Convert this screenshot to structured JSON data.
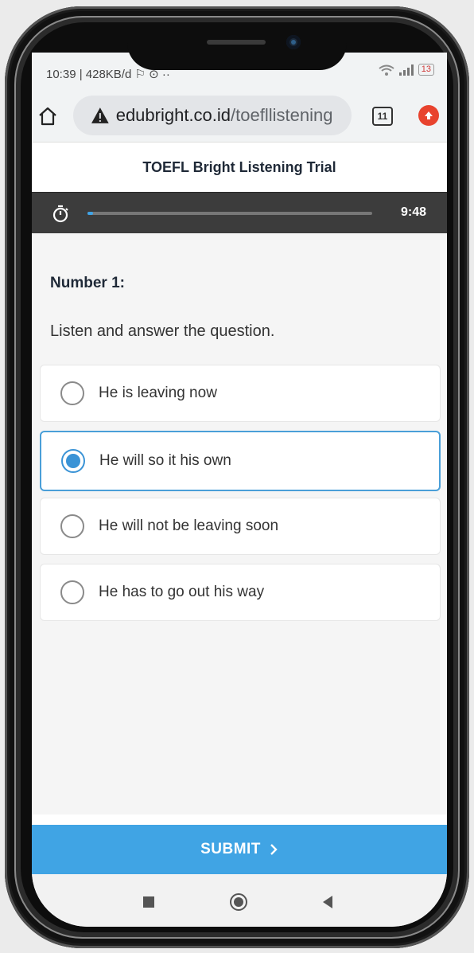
{
  "status_bar": {
    "left_text": "10:39 | 428KB/d ⚐ ⊙ ··",
    "battery": "13"
  },
  "browser": {
    "url_domain": "edubright.co.id",
    "url_path": "/toefllistening",
    "tab_count": "11"
  },
  "page": {
    "title": "TOEFL Bright Listening Trial",
    "timer": "9:48",
    "timer_progress": 0.02
  },
  "question": {
    "number_label": "Number 1:",
    "prompt": "Listen and answer the question.",
    "options": [
      {
        "label": "He is leaving now",
        "selected": false
      },
      {
        "label": "He will so it his own",
        "selected": true
      },
      {
        "label": "He will not be leaving soon",
        "selected": false
      },
      {
        "label": "He has to go out his way",
        "selected": false
      }
    ]
  },
  "submit": {
    "label": "SUBMIT"
  },
  "colors": {
    "accent": "#40a4e4",
    "timer_bar": "#3c3c3c"
  }
}
